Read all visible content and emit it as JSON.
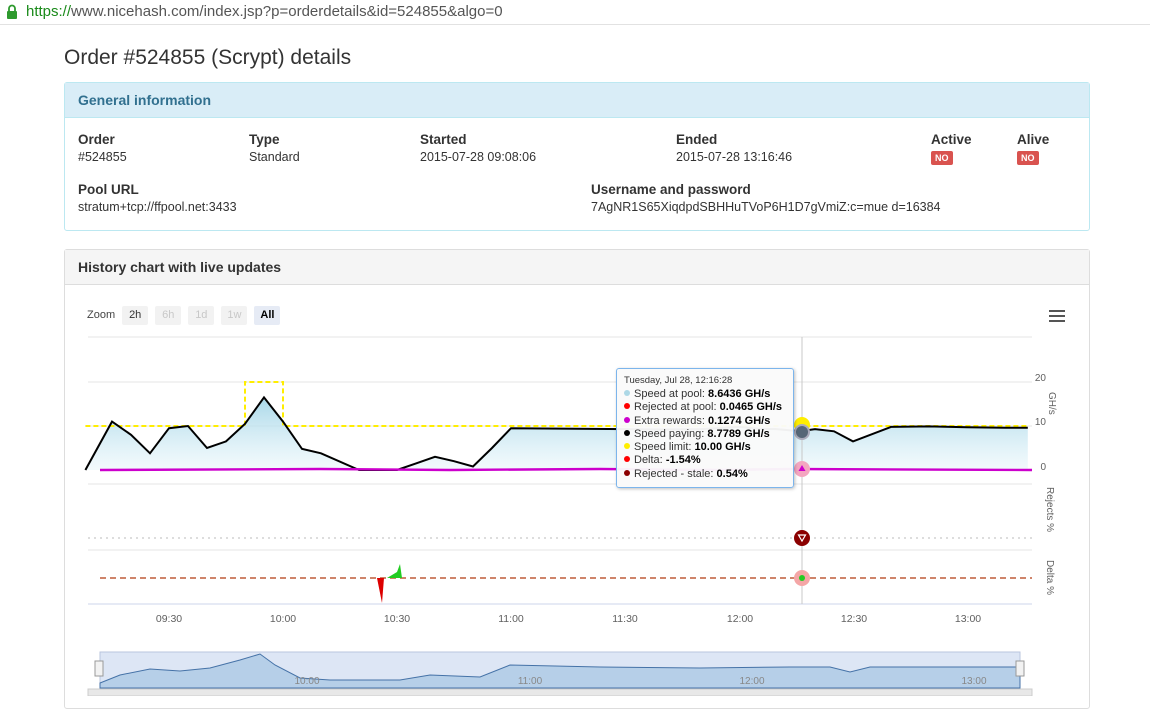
{
  "browser": {
    "url_scheme": "https://",
    "url_rest": "www.nicehash.com/index.jsp?p=orderdetails&id=524855&algo=0"
  },
  "page": {
    "title": "Order #524855 (Scrypt) details"
  },
  "general": {
    "heading": "General information",
    "order_label": "Order",
    "order_value": "#524855",
    "type_label": "Type",
    "type_value": "Standard",
    "started_label": "Started",
    "started_value": "2015-07-28 09:08:06",
    "ended_label": "Ended",
    "ended_value": "2015-07-28 13:16:46",
    "active_label": "Active",
    "active_value": "NO",
    "alive_label": "Alive",
    "alive_value": "NO",
    "pool_label": "Pool URL",
    "pool_value": "stratum+tcp://ffpool.net:3433",
    "user_label": "Username and password",
    "user_value": "7AgNR1S65XiqdpdSBHHuTVoP6H1D7gVmiZ:c=mue d=16384",
    "badge_color": "#d9534f"
  },
  "history": {
    "heading": "History chart with live updates",
    "zoom_label": "Zoom",
    "zoom_buttons": [
      {
        "label": "2h",
        "state": "enabled"
      },
      {
        "label": "6h",
        "state": "disabled"
      },
      {
        "label": "1d",
        "state": "disabled"
      },
      {
        "label": "1w",
        "state": "disabled"
      },
      {
        "label": "All",
        "state": "active"
      }
    ],
    "menu_icon": "hamburger-menu-icon"
  },
  "tooltip": {
    "header": "Tuesday, Jul 28, 12:16:28",
    "rows": [
      {
        "label": "Speed at pool:",
        "value": "8.6436 GH/s",
        "color": "#add8e6"
      },
      {
        "label": "Rejected at pool:",
        "value": "0.0465 GH/s",
        "color": "#ff0000"
      },
      {
        "label": "Extra rewards:",
        "value": "0.1274 GH/s",
        "color": "#cc00cc"
      },
      {
        "label": "Speed paying:",
        "value": "8.7789 GH/s",
        "color": "#000000"
      },
      {
        "label": "Speed limit:",
        "value": "10.00 GH/s",
        "color": "#ffee00"
      },
      {
        "label": "Delta:",
        "value": "-1.54%",
        "color": "#ff0000"
      },
      {
        "label": "Rejected - stale:",
        "value": "0.54%",
        "color": "#8b0000"
      }
    ]
  },
  "chart_data": {
    "type": "line",
    "x_ticks": [
      "09:30",
      "10:00",
      "10:30",
      "11:00",
      "11:30",
      "12:00",
      "12:30",
      "13:00"
    ],
    "navigator_ticks": [
      "10:00",
      "11:00",
      "12:00",
      "13:00"
    ],
    "y_ticks": [
      "20",
      "10",
      "0"
    ],
    "ylabel": "GH/s",
    "rejects_label": "Rejects %",
    "delta_label": "Delta %",
    "x": [
      "09:08",
      "09:15",
      "09:20",
      "09:25",
      "09:30",
      "09:35",
      "09:40",
      "09:45",
      "09:50",
      "09:55",
      "10:00",
      "10:05",
      "10:10",
      "10:20",
      "10:30",
      "10:35",
      "10:40",
      "10:45",
      "10:50",
      "10:55",
      "11:00",
      "11:30",
      "11:40",
      "11:50",
      "12:00",
      "12:05",
      "12:10",
      "12:16",
      "12:20",
      "12:25",
      "12:30",
      "12:40",
      "12:50",
      "13:00",
      "13:10",
      "13:16"
    ],
    "series": [
      {
        "name": "Speed paying",
        "color": "#000000",
        "values": [
          0,
          11,
          8,
          3.8,
          9.5,
          10,
          5,
          6.5,
          10.5,
          16.5,
          11,
          4.8,
          3.8,
          0,
          0,
          1.5,
          3,
          2,
          0.8,
          5,
          9.5,
          9.3,
          9.2,
          9.3,
          9.8,
          9.4,
          9.3,
          8.8,
          9.3,
          8.8,
          6.5,
          9.8,
          9.9,
          9.7,
          9.6,
          9.6
        ]
      },
      {
        "name": "Speed limit",
        "color": "#ffee00",
        "values": [
          10,
          10,
          10,
          10,
          10,
          10,
          10,
          10,
          20,
          20,
          10,
          10,
          10,
          10,
          10,
          10,
          10,
          10,
          10,
          10,
          10,
          10,
          10,
          10,
          10,
          10,
          10,
          10,
          10,
          10,
          10,
          10,
          10,
          10,
          10,
          10
        ]
      }
    ]
  }
}
